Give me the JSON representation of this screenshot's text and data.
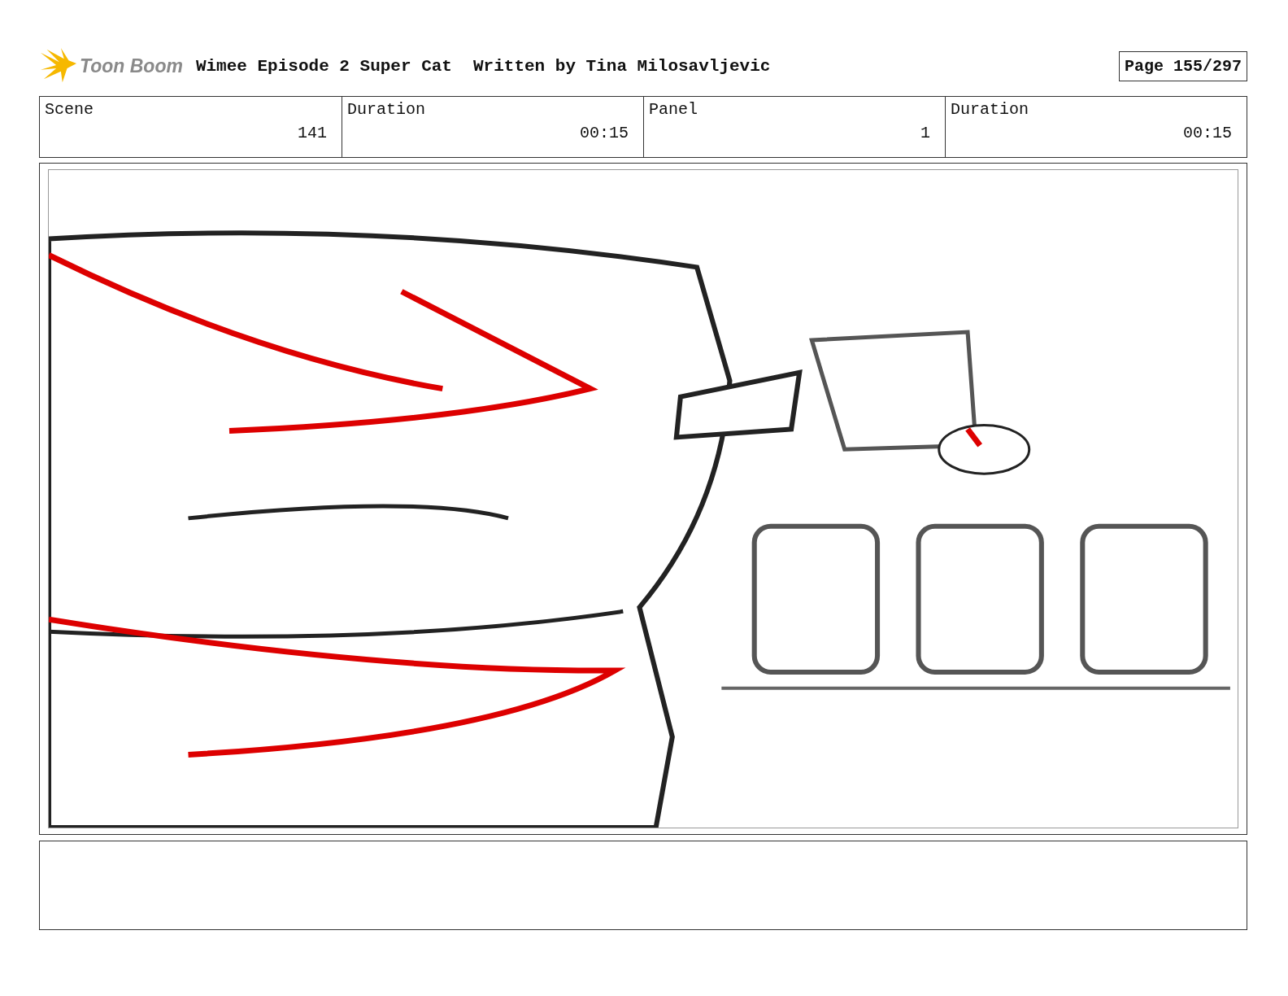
{
  "header": {
    "logo": "Toon Boom",
    "title": "Wimee Episode 2 Super Cat",
    "author": "Written by Tina Milosavljevic",
    "page": "Page 155/297"
  },
  "info": [
    {
      "label": "Scene",
      "value": "141"
    },
    {
      "label": "Duration",
      "value": "00:15"
    },
    {
      "label": "Panel",
      "value": "1"
    },
    {
      "label": "Duration",
      "value": "00:15"
    }
  ]
}
